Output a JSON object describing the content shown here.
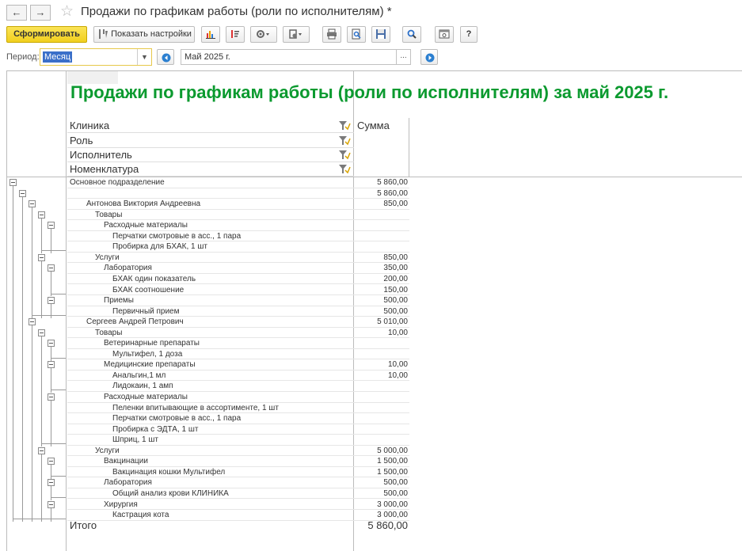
{
  "window": {
    "title": "Продажи по графикам работы (роли по исполнителям) *",
    "back": "←",
    "forward": "→",
    "star": "☆"
  },
  "toolbar": {
    "generate": "Сформировать",
    "show_settings": "Показать настройки",
    "help": "?",
    "icons": [
      "chart-icon",
      "sort-icon",
      "settings-icon",
      "variants-icon",
      "print-icon",
      "preview-icon",
      "save-icon",
      "search-icon",
      "window-icon",
      "help-icon"
    ]
  },
  "period": {
    "label": "Период:",
    "type": "Месяц",
    "value": "Май 2025 г.",
    "dots": "..."
  },
  "report": {
    "title": "Продажи по графикам работы (роли по исполнителям) за май 2025 г.",
    "group_headers": [
      "Клиника",
      "Роль",
      "Исполнитель",
      "Номенклатура"
    ],
    "sum_header": "Сумма",
    "rows": [
      {
        "label": "Основное подразделение",
        "value": "5 860,00"
      },
      {
        "label": "",
        "value": "5 860,00"
      },
      {
        "label": "Антонова Виктория Андреевна",
        "value": "850,00"
      },
      {
        "label": "Товары",
        "value": ""
      },
      {
        "label": "Расходные материалы",
        "value": ""
      },
      {
        "label": "Перчатки смотровые в асс., 1 пара",
        "value": ""
      },
      {
        "label": "Пробирка для БХАК, 1  шт",
        "value": ""
      },
      {
        "label": "Услуги",
        "value": "850,00"
      },
      {
        "label": "Лаборатория",
        "value": "350,00"
      },
      {
        "label": "БХАК один показатель",
        "value": "200,00"
      },
      {
        "label": "БХАК соотношение",
        "value": "150,00"
      },
      {
        "label": "Приемы",
        "value": "500,00"
      },
      {
        "label": "Первичный прием",
        "value": "500,00"
      },
      {
        "label": "Сергеев Андрей Петрович",
        "value": "5 010,00"
      },
      {
        "label": "Товары",
        "value": "10,00"
      },
      {
        "label": "Ветеринарные препараты",
        "value": ""
      },
      {
        "label": "Мультифел, 1 доза",
        "value": ""
      },
      {
        "label": "Медицинские препараты",
        "value": "10,00"
      },
      {
        "label": "Анальгин,1 мл",
        "value": "10,00"
      },
      {
        "label": "Лидокаин, 1 амп",
        "value": ""
      },
      {
        "label": "Расходные материалы",
        "value": ""
      },
      {
        "label": "Пеленки впитывающие в ассортименте, 1 шт",
        "value": ""
      },
      {
        "label": "Перчатки смотровые в асс., 1 пара",
        "value": ""
      },
      {
        "label": "Пробирка с ЭДТА, 1  шт",
        "value": ""
      },
      {
        "label": "Шприц, 1 шт",
        "value": ""
      },
      {
        "label": "Услуги",
        "value": "5 000,00"
      },
      {
        "label": "Вакцинации",
        "value": "1 500,00"
      },
      {
        "label": "Вакцинация кошки Мультифел",
        "value": "1 500,00"
      },
      {
        "label": "Лаборатория",
        "value": "500,00"
      },
      {
        "label": "Общий анализ крови КЛИНИКА",
        "value": "500,00"
      },
      {
        "label": "Хирургия",
        "value": "3 000,00"
      },
      {
        "label": "Кастрация кота",
        "value": "3 000,00"
      }
    ],
    "total_label": "Итого",
    "total_value": "5 860,00"
  }
}
